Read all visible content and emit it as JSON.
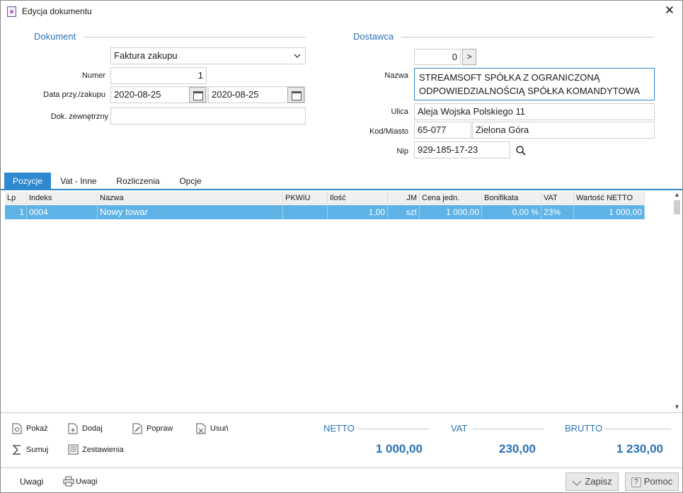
{
  "window": {
    "title": "Edycja dokumentu",
    "close_glyph": "✕"
  },
  "dokument": {
    "section": "Dokument",
    "doc_type": "Faktura zakupu",
    "numer_label": "Numer",
    "numer": "1",
    "data_label": "Data przy./zakupu",
    "data_przyjecia": "2020-08-25",
    "data_zakupu": "2020-08-25",
    "dok_zew_label": "Dok. zewnętrzny",
    "dok_zew": ""
  },
  "dostawca": {
    "section": "Dostawca",
    "counter": "0",
    "next_glyph": ">",
    "nazwa_label": "Nazwa",
    "nazwa_line1": "STREAMSOFT SPÓŁKA Z OGRANICZONĄ",
    "nazwa_line2": "ODPOWIEDZIALNOŚCIĄ SPÓŁKA KOMANDYTOWA",
    "ulica_label": "Ulica",
    "ulica": "Aleja Wojska Polskiego 11",
    "kod_label": "Kod/Miasto",
    "kod": "65-077",
    "miasto": "Zielona Góra",
    "nip_label": "Nip",
    "nip": "929-185-17-23"
  },
  "tabs": [
    "Pozycje",
    "Vat - Inne",
    "Rozliczenia",
    "Opcje"
  ],
  "table": {
    "columns": [
      "Lp",
      "Indeks",
      "Nazwa",
      "PKWiU",
      "Ilość",
      "JM",
      "Cena jedn.",
      "Bonifikata",
      "VAT",
      "Wartość NETTO"
    ],
    "rows": [
      [
        "1",
        "0004",
        "Nowy towar",
        "",
        "1,00",
        "szt",
        "1 000,00",
        "0,00 %",
        "23%",
        "1 000,00"
      ]
    ]
  },
  "actions": {
    "pokaz": "Pokaż",
    "dodaj": "Dodaj",
    "popraw": "Popraw",
    "usun": "Usuń",
    "sumuj": "Sumuj",
    "zestawienia": "Zestawienia"
  },
  "totals": {
    "netto_label": "NETTO",
    "netto": "1 000,00",
    "vat_label": "VAT",
    "vat": "230,00",
    "brutto_label": "BRUTTO",
    "brutto": "1 230,00"
  },
  "footer": {
    "uwagi1": "Uwagi",
    "uwagi2": "Uwagi",
    "zapisz": "Zapisz",
    "pomoc": "Pomoc"
  },
  "colors": {
    "accent": "#2f89d1",
    "selected_row": "#5eb2e5",
    "label_blue": "#2a73b6"
  }
}
